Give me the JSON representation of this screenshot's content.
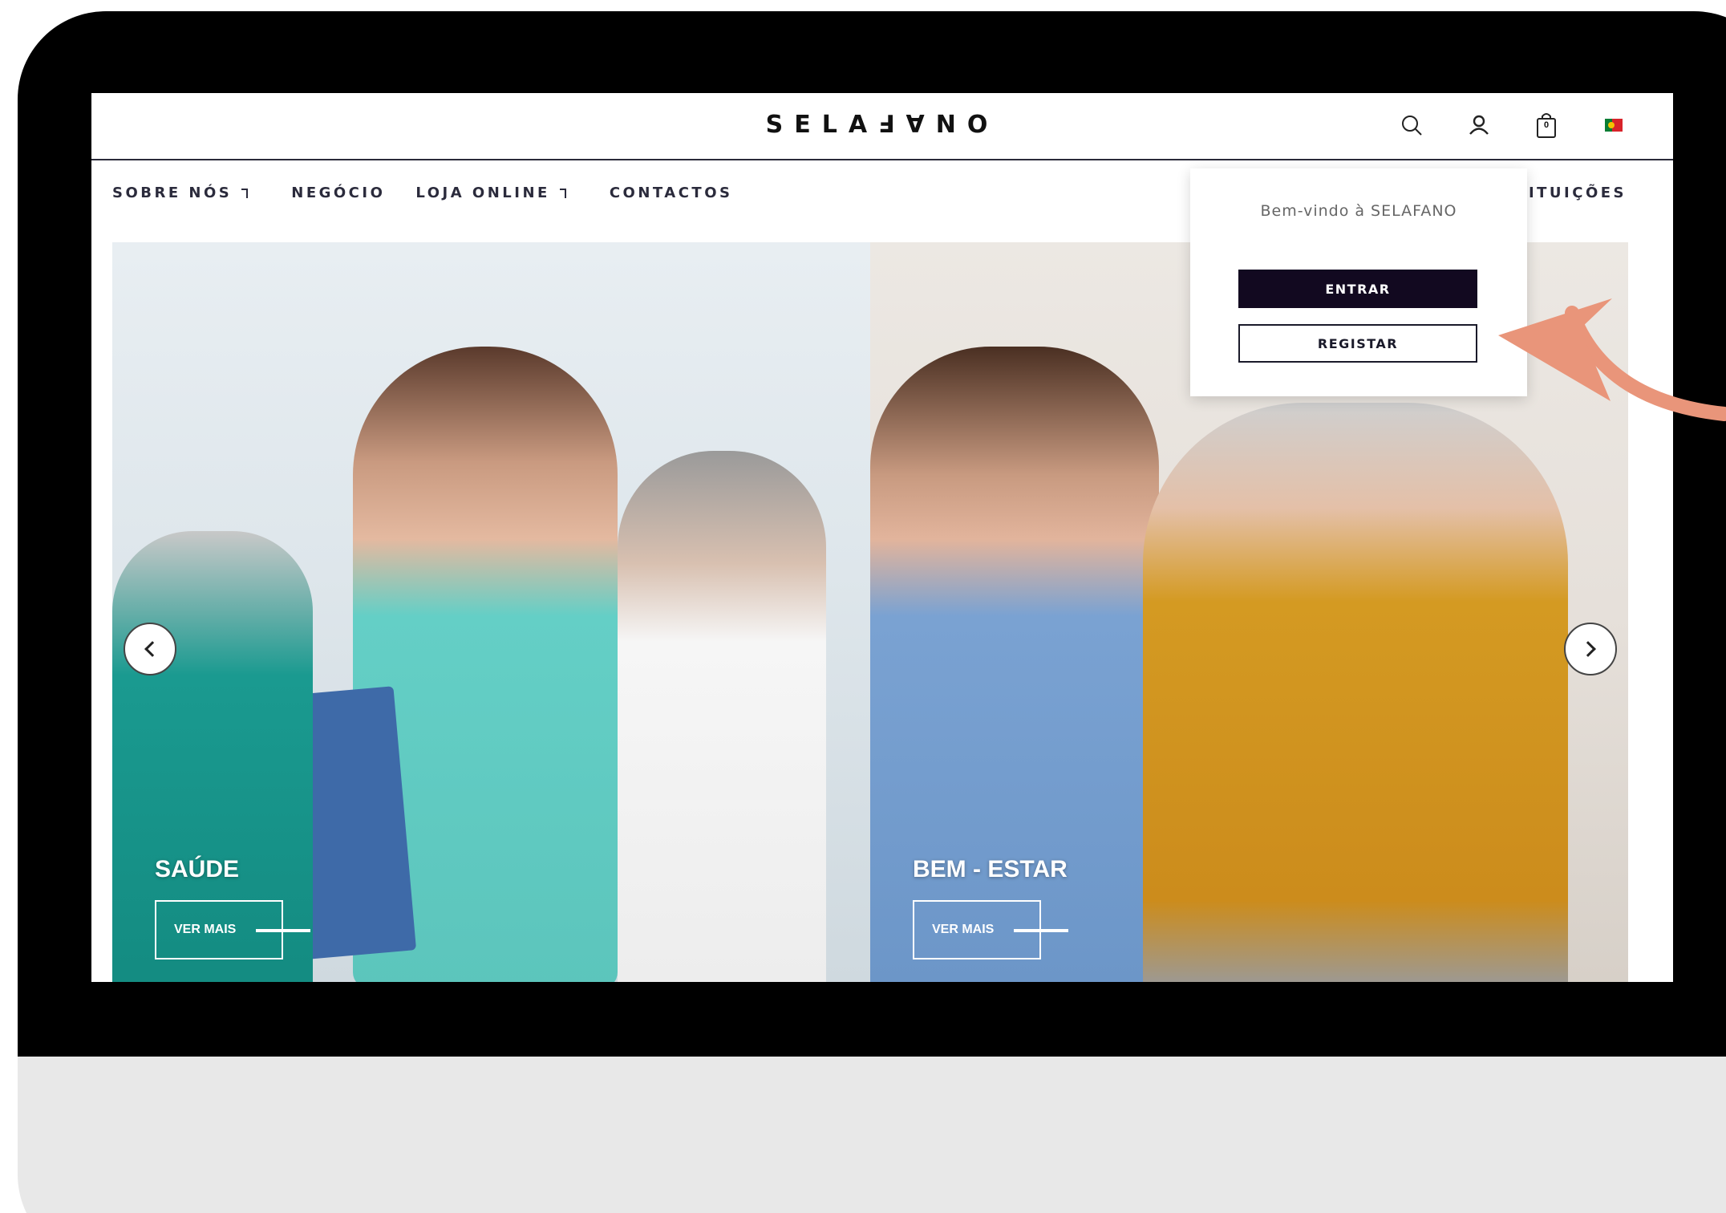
{
  "site": {
    "logo": "SELAℲ∀NO"
  },
  "header": {
    "icons": [
      "search-icon",
      "user-icon",
      "shopping-bag-icon",
      "portugal-flag-icon"
    ],
    "cart_count": "0"
  },
  "nav": {
    "items": [
      {
        "label": "SOBRE NÓS",
        "has_submenu": true
      },
      {
        "label": "NEGÓCIO",
        "has_submenu": false
      },
      {
        "label": "LOJA ONLINE",
        "has_submenu": true
      },
      {
        "label": "CONTACTOS",
        "has_submenu": false
      }
    ],
    "right_item": "ISTITUIÇÕES"
  },
  "account_dropdown": {
    "welcome": "Bem-vindo à SELAFANO",
    "login_label": "ENTRAR",
    "register_label": "REGISTAR"
  },
  "hero": {
    "panels": [
      {
        "caption": "SAÚDE",
        "button_label": "VER MAIS"
      },
      {
        "caption": "BEM - ESTAR",
        "button_label": "VER MAIS"
      }
    ]
  },
  "colors": {
    "primary_dark": "#120920",
    "annotation": "#e9957a",
    "bezel": "#000000",
    "stand": "#e8e8e8"
  }
}
